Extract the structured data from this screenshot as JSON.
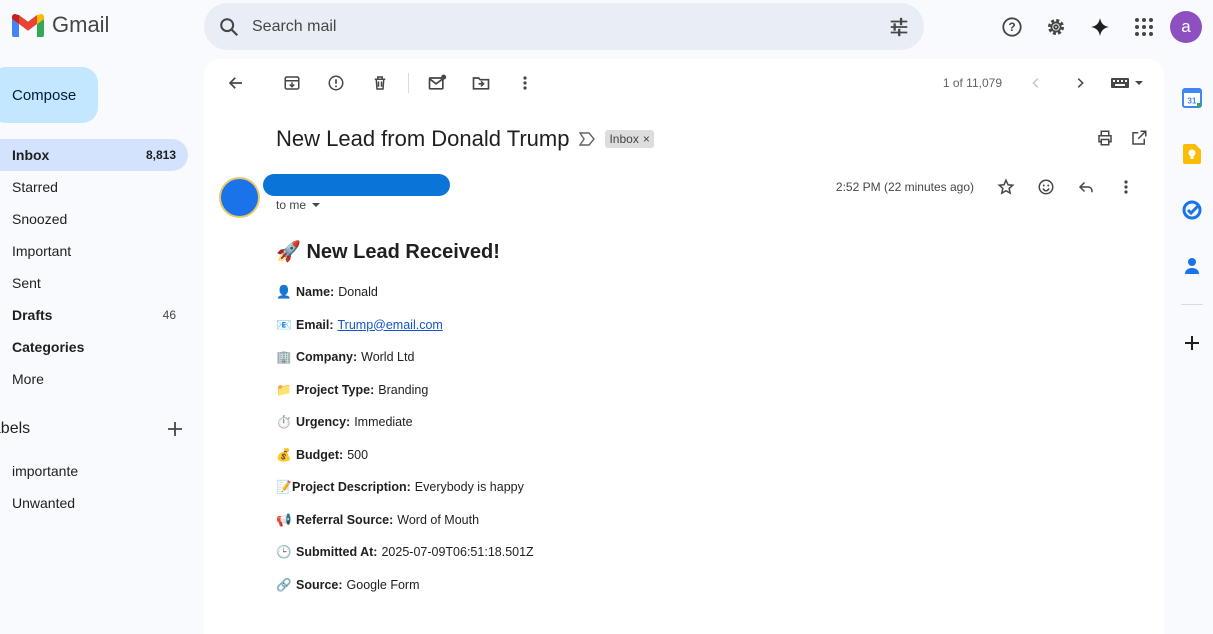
{
  "app": {
    "name": "Gmail"
  },
  "search": {
    "placeholder": "Search mail"
  },
  "user": {
    "initial": "a"
  },
  "sidebar": {
    "compose_label": "Compose",
    "items": [
      {
        "label": "Inbox",
        "count": "8,813"
      },
      {
        "label": "Starred",
        "count": ""
      },
      {
        "label": "Snoozed",
        "count": ""
      },
      {
        "label": "Important",
        "count": ""
      },
      {
        "label": "Sent",
        "count": ""
      },
      {
        "label": "Drafts",
        "count": "46"
      },
      {
        "label": "Categories",
        "count": ""
      },
      {
        "label": "More",
        "count": ""
      }
    ],
    "labels_heading": "Labels",
    "labels": [
      {
        "label": "importante"
      },
      {
        "label": "Unwanted"
      }
    ]
  },
  "toolbar": {
    "pager_text": "1 of 11,079"
  },
  "email": {
    "subject": "New Lead from Donald Trump",
    "chip_label": "Inbox",
    "chip_close": "×",
    "to_text": "to me",
    "time": "2:52 PM (22 minutes ago)",
    "heading_emoji": "🚀",
    "heading": "New Lead Received!",
    "fields": [
      {
        "emoji": "👤",
        "label": "Name:",
        "value": "Donald"
      },
      {
        "emoji": "📧",
        "label": "Email:",
        "value": "Trump@email.com",
        "link": true
      },
      {
        "emoji": "🏢",
        "label": "Company:",
        "value": "World Ltd"
      },
      {
        "emoji": "📁",
        "label": "Project Type:",
        "value": "Branding"
      },
      {
        "emoji": "⏱️",
        "label": "Urgency:",
        "value": "Immediate"
      },
      {
        "emoji": "💰",
        "label": "Budget:",
        "value": "500"
      },
      {
        "emoji": "📝",
        "label": "Project Description:",
        "value": "Everybody is happy"
      },
      {
        "emoji": "📢",
        "label": "Referral Source:",
        "value": "Word of Mouth"
      },
      {
        "emoji": "🕒",
        "label": "Submitted At:",
        "value": "2025-07-09T06:51:18.501Z"
      },
      {
        "emoji": "🔗",
        "label": "Source:",
        "value": "Google Form"
      }
    ]
  },
  "icons": {
    "calendar_day": "31"
  }
}
